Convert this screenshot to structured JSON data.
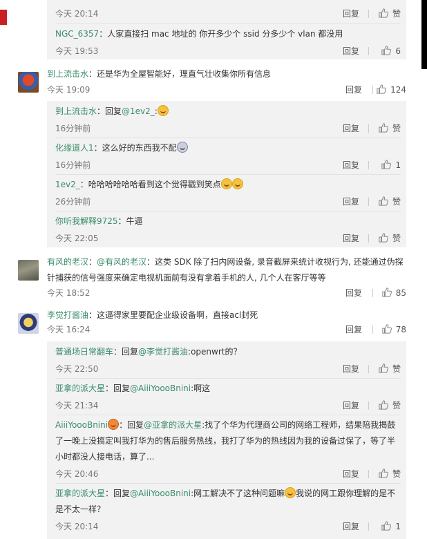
{
  "ui": {
    "reply_label": "回复",
    "like_label": "赞"
  },
  "top_sub": [
    {
      "time": "今天 20:14",
      "like": "赞"
    },
    {
      "user": "NGC_6357",
      "text": "：人家直接扫 mac 地址的 你开多少个 ssid 分多少个 vlan 都没用",
      "time": "今天 19:53",
      "like": "6"
    }
  ],
  "threads": [
    {
      "user": "到上流击水",
      "text": "：还是华为全屋智能好，理直气壮收集你所有信息",
      "time": "今天 19:09",
      "like": "124",
      "replies": [
        {
          "user": "到上流击水",
          "prefix": "：回复",
          "at": "@1ev2_",
          "text": ":",
          "emoji": 1,
          "time": "16分钟前",
          "like": "赞"
        },
        {
          "user": "化缘道人1",
          "text": "：这么好的东西我不配",
          "emoji_dark": 1,
          "time": "16分钟前",
          "like": "1"
        },
        {
          "user": "1ev2_",
          "text": "：哈哈哈哈哈哈看到这个觉得戳到笑点",
          "emoji": 2,
          "time": "26分钟前",
          "like": "赞"
        },
        {
          "user": "你听我解释9725",
          "text": "：牛逼",
          "time": "今天 22:05",
          "like": "赞"
        }
      ]
    },
    {
      "user": "有风的老汉",
      "prefix": "：",
      "at": "@有风的老汉",
      "text": "：这类 SDK 除了扫内网设备, 录音截屏来统计收视行为, 还能通过伪探针捕获的信号强度来确定电视机面前有没有拿着手机的人, 几个人在客厅等等",
      "time": "今天 18:52",
      "like": "85"
    },
    {
      "user": "李觉打酱油",
      "text": "：这逼得家里要配企业级设备啊，直接acl封死",
      "time": "今天 16:24",
      "like": "78",
      "replies": [
        {
          "user": "普通场日常翻车",
          "prefix": "：回复",
          "at": "@李觉打酱油",
          "text": ":openwrt的？",
          "time": "今天 22:50",
          "like": "赞"
        },
        {
          "user": "亚拿的派大星",
          "prefix": "：回复",
          "at": "@AiiiYoooBnini",
          "text": ":啊这",
          "time": "今天 21:34",
          "like": "赞"
        },
        {
          "user": "AiiiYoooBnini",
          "prefix": "：回复",
          "at": "@亚拿的派大星",
          "text": ":找了个华为代理商公司的网络工程师，结果陪我揭鼓了一晚上没搞定叫我打华为的售后服务热线，我打了华为的热线因为我的设备过保了，等了半小时都没人接电话，算了...",
          "time": "今天 20:46",
          "like": "赞"
        },
        {
          "user": "亚拿的派大星",
          "prefix": "：回复",
          "at": "@AiiiYoooBnini",
          "text": ":网工解决不了这种问题嘛",
          "text2": "我说的网工跟你理解的是不是不太一样？",
          "time": "今天 20:14",
          "like": "1"
        }
      ]
    }
  ]
}
